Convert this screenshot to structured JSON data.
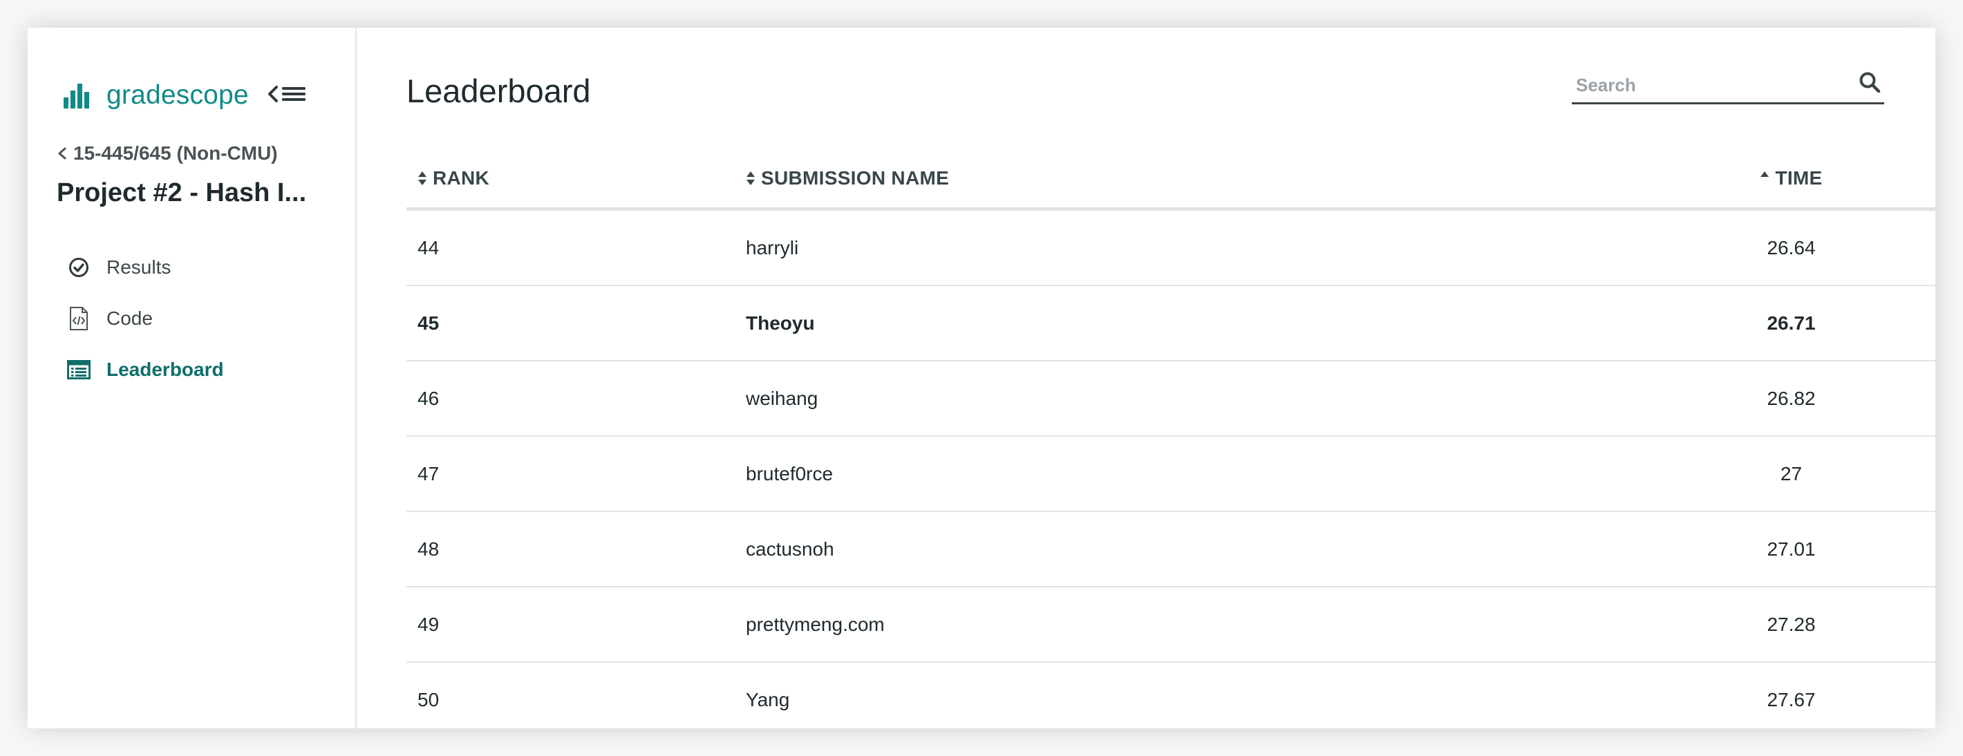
{
  "brand": {
    "name": "gradescope",
    "accent": "#118a87"
  },
  "sidebar": {
    "course_label": "15-445/645 (Non-CMU)",
    "assignment_title": "Project #2 - Hash I...",
    "items": [
      {
        "label": "Results",
        "icon": "check-circle-icon",
        "active": false
      },
      {
        "label": "Code",
        "icon": "code-file-icon",
        "active": false
      },
      {
        "label": "Leaderboard",
        "icon": "leaderboard-list-icon",
        "active": true
      }
    ]
  },
  "main": {
    "title": "Leaderboard",
    "search": {
      "placeholder": "Search",
      "value": ""
    },
    "columns": {
      "rank": "RANK",
      "submission_name": "SUBMISSION NAME",
      "time": "TIME"
    },
    "rows": [
      {
        "rank": "44",
        "name": "harryli",
        "time": "26.64",
        "highlight": false
      },
      {
        "rank": "45",
        "name": "Theoyu",
        "time": "26.71",
        "highlight": true
      },
      {
        "rank": "46",
        "name": "weihang",
        "time": "26.82",
        "highlight": false
      },
      {
        "rank": "47",
        "name": "brutef0rce",
        "time": "27",
        "highlight": false
      },
      {
        "rank": "48",
        "name": "cactusnoh",
        "time": "27.01",
        "highlight": false
      },
      {
        "rank": "49",
        "name": "prettymeng.com",
        "time": "27.28",
        "highlight": false
      },
      {
        "rank": "50",
        "name": "Yang",
        "time": "27.67",
        "highlight": false
      }
    ]
  }
}
